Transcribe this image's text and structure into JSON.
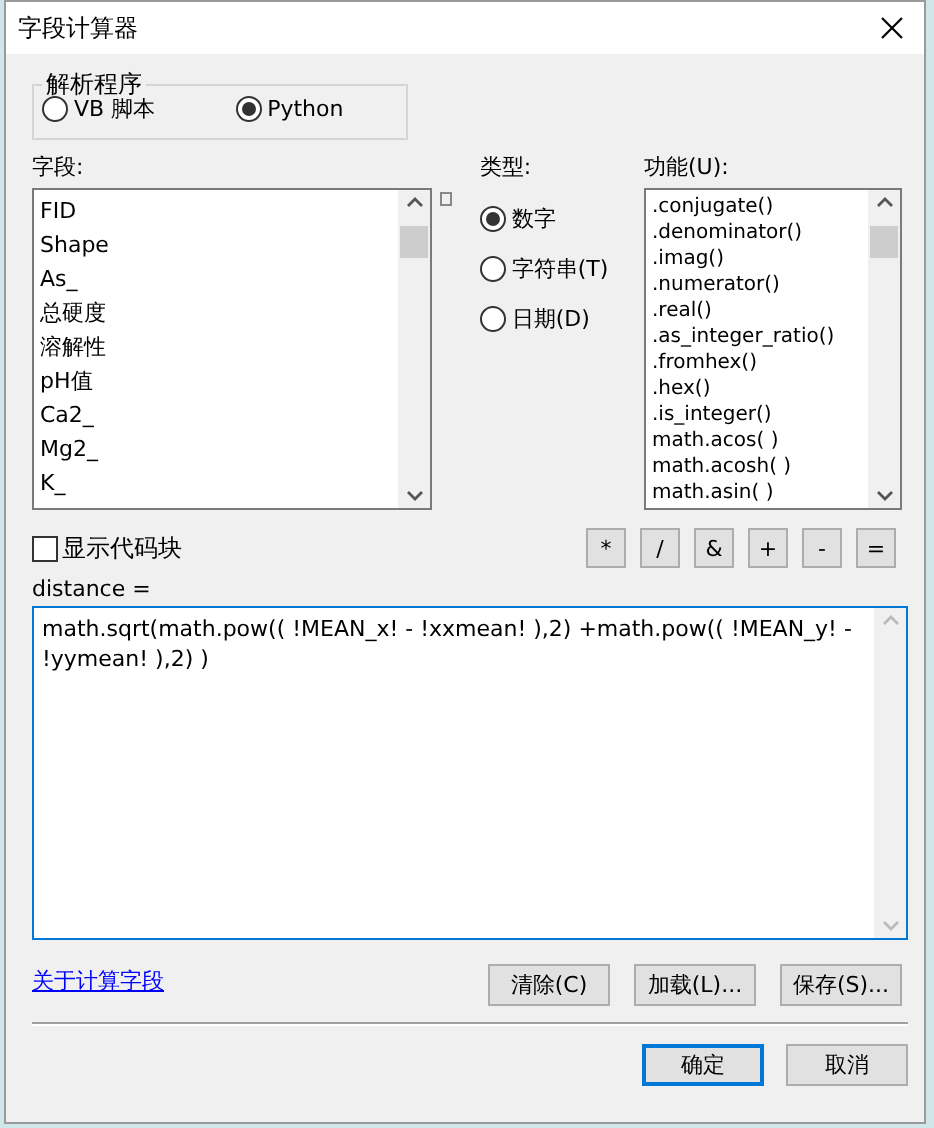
{
  "window": {
    "title": "字段计算器"
  },
  "parser": {
    "title": "解析程序",
    "options": [
      {
        "label": "VB 脚本",
        "selected": false
      },
      {
        "label": "Python",
        "selected": true
      }
    ]
  },
  "fields": {
    "label": "字段:",
    "items": [
      "FID",
      "Shape",
      "As_",
      "总硬度",
      "溶解性",
      "pH值",
      "Ca2_",
      "Mg2_",
      "K_"
    ]
  },
  "type": {
    "label": "类型:",
    "options": [
      {
        "label": "数字",
        "selected": true
      },
      {
        "label": "字符串(T)",
        "selected": false
      },
      {
        "label": "日期(D)",
        "selected": false
      }
    ]
  },
  "functions": {
    "label": "功能(U):",
    "items": [
      ".conjugate()",
      ".denominator()",
      ".imag()",
      ".numerator()",
      ".real()",
      ".as_integer_ratio()",
      ".fromhex()",
      ".hex()",
      ".is_integer()",
      "math.acos( )",
      "math.acosh( )",
      "math.asin( )"
    ]
  },
  "show_code_block": {
    "label": "显示代码块",
    "checked": false
  },
  "operators": [
    "*",
    "/",
    "&",
    "+",
    "-",
    "="
  ],
  "expression": {
    "label": "distance =",
    "value": "math.sqrt(math.pow(( !MEAN_x! - !xxmean! ),2) +math.pow(( !MEAN_y! - !yymean! ),2) )"
  },
  "help_link": "关于计算字段",
  "tool_buttons": [
    "清除(C)",
    "加载(L)...",
    "保存(S)..."
  ],
  "dialog_buttons": [
    {
      "label": "确定",
      "selected": true
    },
    {
      "label": "取消",
      "selected": false
    }
  ]
}
